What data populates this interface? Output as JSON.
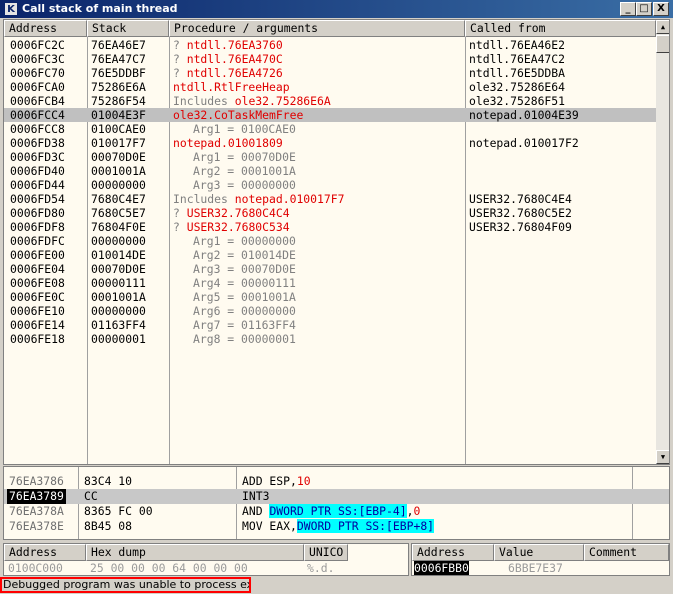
{
  "window": {
    "title": "Call stack of main thread",
    "app_icon_letter": "K",
    "buttons": {
      "minimize": "_",
      "maximize": "□",
      "close": "X"
    }
  },
  "callstack": {
    "columns": [
      "Address",
      "Stack",
      "Procedure / arguments",
      "Called from"
    ],
    "rows": [
      {
        "addr": "0006FC2C",
        "stack": "76EA46E7",
        "prefix": "?",
        "proc": "ntdll.76EA3760",
        "called": "ntdll.76EA46E2",
        "style": "red"
      },
      {
        "addr": "0006FC3C",
        "stack": "76EA47C7",
        "prefix": "?",
        "proc": "ntdll.76EA470C",
        "called": "ntdll.76EA47C2",
        "style": "red"
      },
      {
        "addr": "0006FC70",
        "stack": "76E5DDBF",
        "prefix": "?",
        "proc": "ntdll.76EA4726",
        "called": "ntdll.76E5DDBA",
        "style": "red"
      },
      {
        "addr": "0006FCA0",
        "stack": "75286E6A",
        "prefix": "",
        "proc": "ntdll.RtlFreeHeap",
        "called": "ole32.75286E64",
        "style": "red"
      },
      {
        "addr": "0006FCB4",
        "stack": "75286F54",
        "prefix": "Includes",
        "proc": "ole32.75286E6A",
        "called": "ole32.75286F51",
        "style": "red"
      },
      {
        "addr": "0006FCC4",
        "stack": "01004E3F",
        "prefix": "",
        "proc": "ole32.CoTaskMemFree",
        "called": "notepad.01004E39",
        "style": "red",
        "selected": true
      },
      {
        "addr": "0006FCC8",
        "stack": "0100CAE0",
        "prefix": "",
        "proc": "Arg1 = 0100CAE0",
        "called": "",
        "style": "arg"
      },
      {
        "addr": "0006FD38",
        "stack": "010017F7",
        "prefix": "",
        "proc": "notepad.01001809",
        "called": "notepad.010017F2",
        "style": "red"
      },
      {
        "addr": "0006FD3C",
        "stack": "00070D0E",
        "prefix": "",
        "proc": "Arg1 = 00070D0E",
        "called": "",
        "style": "arg"
      },
      {
        "addr": "0006FD40",
        "stack": "0001001A",
        "prefix": "",
        "proc": "Arg2 = 0001001A",
        "called": "",
        "style": "arg"
      },
      {
        "addr": "0006FD44",
        "stack": "00000000",
        "prefix": "",
        "proc": "Arg3 = 00000000",
        "called": "",
        "style": "arg"
      },
      {
        "addr": "0006FD54",
        "stack": "7680C4E7",
        "prefix": "Includes",
        "proc": "notepad.010017F7",
        "called": "USER32.7680C4E4",
        "style": "red"
      },
      {
        "addr": "0006FD80",
        "stack": "7680C5E7",
        "prefix": "?",
        "proc": "USER32.7680C4C4",
        "called": "USER32.7680C5E2",
        "style": "red"
      },
      {
        "addr": "0006FDF8",
        "stack": "76804F0E",
        "prefix": "?",
        "proc": "USER32.7680C534",
        "called": "USER32.76804F09",
        "style": "red"
      },
      {
        "addr": "0006FDFC",
        "stack": "00000000",
        "prefix": "",
        "proc": "Arg1 = 00000000",
        "called": "",
        "style": "arg"
      },
      {
        "addr": "0006FE00",
        "stack": "010014DE",
        "prefix": "",
        "proc": "Arg2 = 010014DE",
        "called": "",
        "style": "arg"
      },
      {
        "addr": "0006FE04",
        "stack": "00070D0E",
        "prefix": "",
        "proc": "Arg3 = 00070D0E",
        "called": "",
        "style": "arg"
      },
      {
        "addr": "0006FE08",
        "stack": "00000111",
        "prefix": "",
        "proc": "Arg4 = 00000111",
        "called": "",
        "style": "arg"
      },
      {
        "addr": "0006FE0C",
        "stack": "0001001A",
        "prefix": "",
        "proc": "Arg5 = 0001001A",
        "called": "",
        "style": "arg"
      },
      {
        "addr": "0006FE10",
        "stack": "00000000",
        "prefix": "",
        "proc": "Arg6 = 00000000",
        "called": "",
        "style": "arg"
      },
      {
        "addr": "0006FE14",
        "stack": "01163FF4",
        "prefix": "",
        "proc": "Arg7 = 01163FF4",
        "called": "",
        "style": "arg"
      },
      {
        "addr": "0006FE18",
        "stack": "00000001",
        "prefix": "",
        "proc": "Arg8 = 00000001",
        "called": "",
        "style": "arg"
      }
    ]
  },
  "disasm": {
    "rows": [
      {
        "addr": "76EA3786",
        "hex": "83C4 10",
        "cmd_parts": [
          {
            "t": "ADD ESP,",
            "c": ""
          },
          {
            "t": "10",
            "c": "red"
          }
        ]
      },
      {
        "addr": "76EA3789",
        "hex": "CC",
        "cmd_parts": [
          {
            "t": "INT3",
            "c": ""
          }
        ],
        "selected": true
      },
      {
        "addr": "76EA378A",
        "hex": "8365 FC 00",
        "cmd_parts": [
          {
            "t": "AND ",
            "c": ""
          },
          {
            "t": "DWORD PTR SS:[EBP-4]",
            "c": "hl"
          },
          {
            "t": ",",
            "c": ""
          },
          {
            "t": "0",
            "c": "red"
          }
        ]
      },
      {
        "addr": "76EA378E",
        "hex": "8B45 08",
        "cmd_parts": [
          {
            "t": "MOV EAX,",
            "c": ""
          },
          {
            "t": "DWORD PTR SS:[EBP+8]",
            "c": "hl"
          }
        ]
      }
    ]
  },
  "dump": {
    "columns": [
      "Address",
      "Hex dump",
      "UNICO"
    ],
    "first_row": {
      "addr": "0100C000",
      "hex": "25 00 00 00 64 00 00 00",
      "text": "%.d."
    }
  },
  "registers": {
    "columns": [
      "Address",
      "Value",
      "Comment"
    ],
    "first_row": {
      "addr": "0006FBB0",
      "value": "6BBE7E37"
    }
  },
  "status": {
    "message": "Debugged program was unable to process exception"
  }
}
